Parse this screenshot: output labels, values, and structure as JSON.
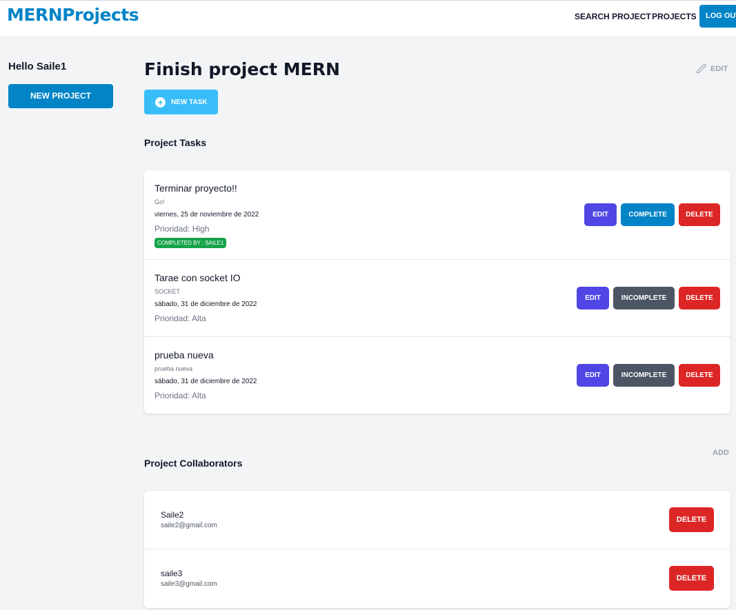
{
  "header": {
    "logo": "MERNProjects",
    "nav": [
      "SEARCH PROJECT",
      "PROJECTS"
    ],
    "logout": "LOG OUT"
  },
  "sidebar": {
    "greeting": "Hello Saile1",
    "new_project": "NEW PROJECT"
  },
  "project": {
    "title": "Finish project MERN",
    "edit_label": "EDIT",
    "new_task_label": "NEW TASK",
    "tasks_heading": "Project Tasks",
    "collaborators_heading": "Project Collaborators",
    "add_label": "ADD"
  },
  "tasks": [
    {
      "name": "Terminar proyecto!!",
      "description": "Go!",
      "date": "viernes, 25 de noviembre de 2022",
      "priority": "Prioridad: High",
      "completed_by": "COMPLETED BY : SAILE1",
      "buttons": [
        "EDIT",
        "COMPLETE",
        "DELETE"
      ]
    },
    {
      "name": "Tarae con socket IO",
      "description": "SOCKET",
      "date": "sábado, 31 de diciembre de 2022",
      "priority": "Prioridad: Alta",
      "buttons": [
        "EDIT",
        "INCOMPLETE",
        "DELETE"
      ]
    },
    {
      "name": "prueba nueva",
      "description": "prueba nueva",
      "date": "sábado, 31 de diciembre de 2022",
      "priority": "Prioridad: Alta",
      "buttons": [
        "EDIT",
        "INCOMPLETE",
        "DELETE"
      ]
    }
  ],
  "collaborators": [
    {
      "name": "Saile2",
      "email": "saile2@gmail.com",
      "delete": "DELETE"
    },
    {
      "name": "saile3",
      "email": "saile3@gmail.com",
      "delete": "DELETE"
    }
  ],
  "colors": {
    "brand": "#0284c7",
    "new_task": "#38bdf8",
    "edit": "#4f46e5",
    "incomplete": "#4b5563",
    "delete": "#dc2626",
    "completed_badge": "#16a34a"
  },
  "icons": [
    "pencil-icon",
    "plus-circle-icon"
  ]
}
